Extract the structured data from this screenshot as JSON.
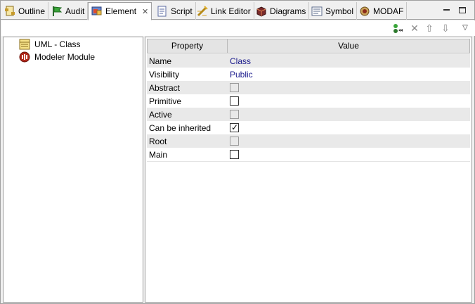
{
  "tabs": [
    {
      "label": "Outline",
      "icon": "outline-icon"
    },
    {
      "label": "Audit",
      "icon": "flag-icon"
    },
    {
      "label": "Element",
      "icon": "element-icon",
      "active": true
    },
    {
      "label": "Script",
      "icon": "script-icon"
    },
    {
      "label": "Link Editor",
      "icon": "link-editor-icon"
    },
    {
      "label": "Diagrams",
      "icon": "diagrams-icon"
    },
    {
      "label": "Symbol",
      "icon": "symbol-icon"
    },
    {
      "label": "MODAF",
      "icon": "modaf-icon"
    }
  ],
  "tree": {
    "items": [
      {
        "label": "UML - Class",
        "icon": "uml-class-icon"
      },
      {
        "label": "Modeler Module",
        "icon": "modeler-module-icon"
      }
    ]
  },
  "table": {
    "headers": {
      "property": "Property",
      "value": "Value"
    },
    "rows": [
      {
        "name": "Name",
        "value": "Class",
        "kind": "text"
      },
      {
        "name": "Visibility",
        "value": "Public",
        "kind": "text"
      },
      {
        "name": "Abstract",
        "kind": "checkbox",
        "checked": false,
        "enabled": false
      },
      {
        "name": "Primitive",
        "kind": "checkbox",
        "checked": false,
        "enabled": true
      },
      {
        "name": "Active",
        "kind": "checkbox",
        "checked": false,
        "enabled": false
      },
      {
        "name": "Can be inherited",
        "kind": "checkbox",
        "checked": true,
        "enabled": true
      },
      {
        "name": "Root",
        "kind": "checkbox",
        "checked": false,
        "enabled": false
      },
      {
        "name": "Main",
        "kind": "checkbox",
        "checked": false,
        "enabled": true
      }
    ]
  },
  "colors": {
    "value_text": "#1a1a8c",
    "row_shade": "#e9e9e9"
  }
}
